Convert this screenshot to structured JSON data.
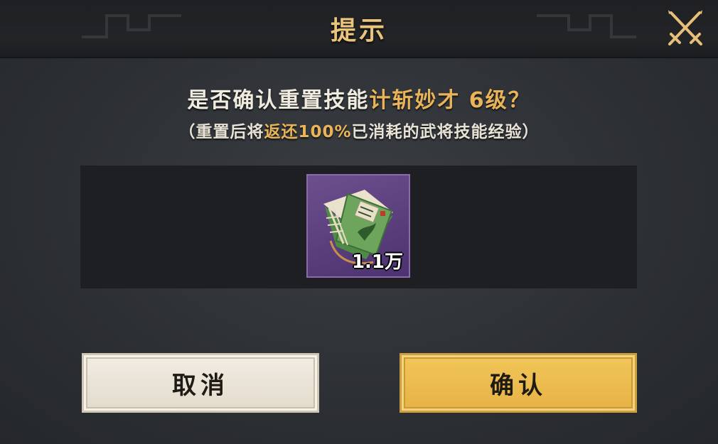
{
  "dialog": {
    "title": "提示",
    "message": {
      "prefix": "是否确认重置技能",
      "skill_name": "计斩妙才",
      "level_suffix": " 6级？"
    },
    "note": {
      "open_paren": "（",
      "before": "重置后将",
      "highlight": "返还100%",
      "after": "已消耗的武将技能经验",
      "close_paren": "）"
    },
    "reward": {
      "icon": "skill-book-icon",
      "count": "1.1万"
    },
    "buttons": {
      "cancel_label": "取消",
      "confirm_label": "确认"
    },
    "close_icon": "crossed-swords-close-icon",
    "colors": {
      "title": "#e9c47a",
      "highlight": "#e9b458",
      "confirm_button": "#f2c65a",
      "cancel_button": "#f2ede3",
      "item_frame": "#5b3f7d"
    }
  }
}
